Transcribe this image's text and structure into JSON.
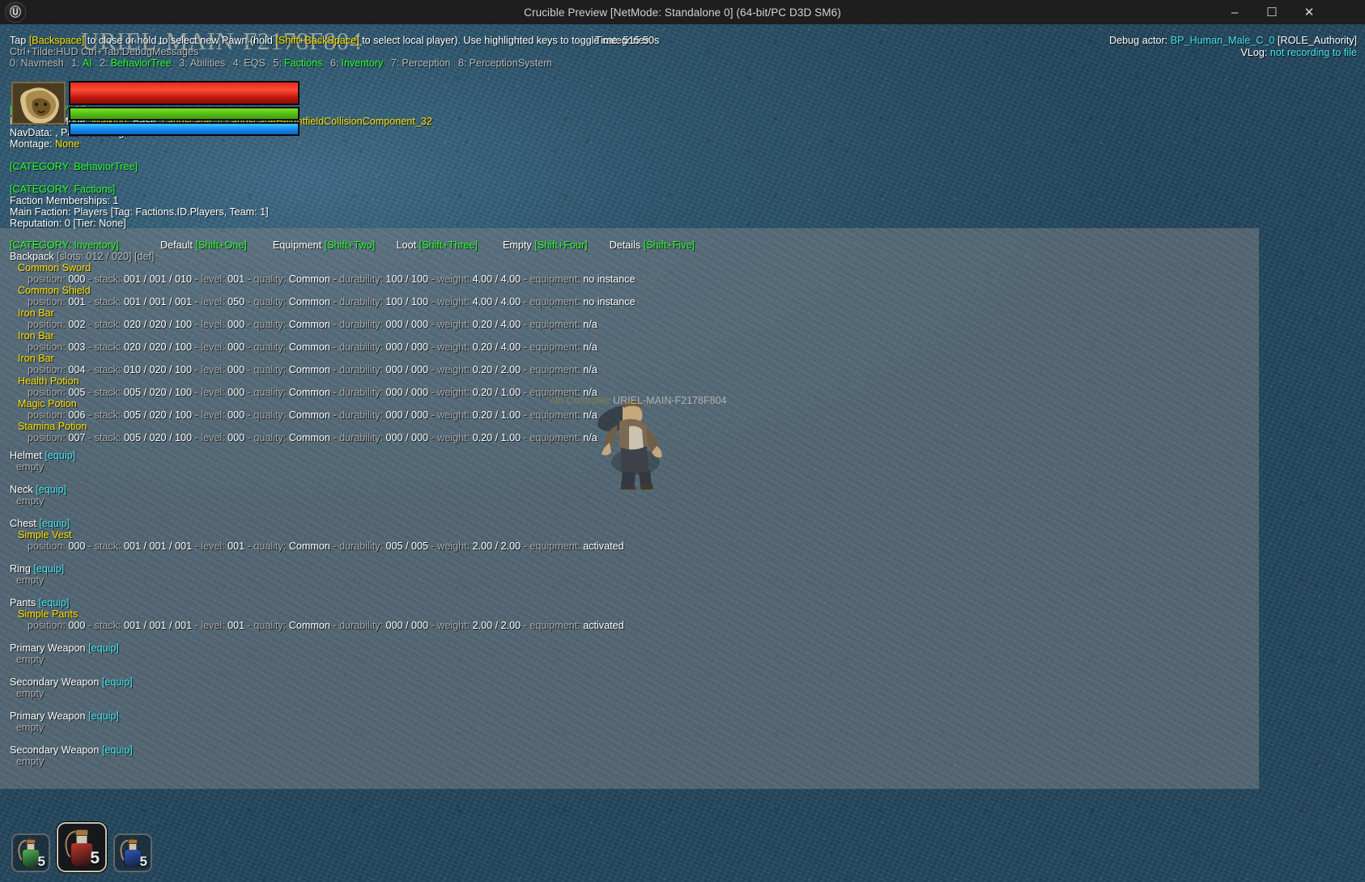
{
  "window": {
    "title": "Crucible Preview [NetMode: Standalone 0]  (64-bit/PC D3D SM6)",
    "logo_glyph": "Ⓤ",
    "minimize_glyph": "–",
    "maximize_glyph": "☐",
    "close_glyph": "✕"
  },
  "watermark": "URIEL-MAIN-F2178F804",
  "header": {
    "help_line_1_a": "Tap ",
    "help_line_1_key1": "[Backspace]",
    "help_line_1_b": " to close or hold to select new Pawn (hold ",
    "help_line_1_key2": "[Shift+BackSpace]",
    "help_line_1_c": " to select local player). Use highlighted keys to toggle categories.",
    "help_line_2": "Ctrl+Tilde:HUD  Ctrl+Tab:DebugMessages",
    "time": "Time: 515.50s",
    "debug_actor_label": "Debug actor: ",
    "debug_actor_name": "BP_Human_Male_C_0",
    "debug_actor_role": " [ROLE_Authority]",
    "vlog_label": "VLog: ",
    "vlog_value": "not recording to file"
  },
  "categories": [
    {
      "key": "0",
      "name": "Navmesh",
      "active": false
    },
    {
      "key": "1",
      "name": "AI",
      "active": true
    },
    {
      "key": "2",
      "name": "BehaviorTree",
      "active": true
    },
    {
      "key": "3",
      "name": "Abilities",
      "active": false
    },
    {
      "key": "4",
      "name": "EQS",
      "active": false
    },
    {
      "key": "5",
      "name": "Factions",
      "active": true
    },
    {
      "key": "6",
      "name": "Inventory",
      "active": true
    },
    {
      "key": "7",
      "name": "Perception",
      "active": false
    },
    {
      "key": "8",
      "name": "PerceptionSystem",
      "active": false
    }
  ],
  "category_ai": {
    "title": "[CATEGORY: AI]",
    "movement_label": "Movement Mode: ",
    "movement_value": "Walking",
    "base_label": ", Base: ",
    "base_value": "Landscape_4.LandscapeHeightfieldCollisionComponent_32",
    "navdata_line": "NavData: , Path following:",
    "montage_label": "Montage: ",
    "montage_value": "None"
  },
  "category_behaviortree": {
    "title": "[CATEGORY: BehaviorTree]"
  },
  "category_factions": {
    "title": "[CATEGORY: Factions]",
    "lines": [
      "Faction Memberships: 1",
      "Main Faction: Players [Tag: Factions.ID.Players, Team: 1]",
      "Reputation: 0 [Tier: None]"
    ]
  },
  "category_inventory": {
    "title": "[CATEGORY: Inventory]",
    "view_tabs": [
      {
        "label": "Default",
        "key": "[Shift+One]"
      },
      {
        "label": "Equipment",
        "key": "[Shift+Two]"
      },
      {
        "label": "Loot",
        "key": "[Shift+Three]"
      },
      {
        "label": "Empty",
        "key": "[Shift+Four]"
      },
      {
        "label": "Details",
        "key": "[Shift+Five]"
      }
    ],
    "backpack_label": "Backpack",
    "backpack_slots": "[slots: 012 / 020]",
    "backpack_def": "[def]",
    "items": [
      {
        "name": "Common Sword",
        "position": "000",
        "stack": "001 / 001 / 010",
        "level": "001",
        "quality": "Common",
        "durability": "100 / 100",
        "weight": "4.00 / 4.00",
        "equipment": "no instance"
      },
      {
        "name": "Common Shield",
        "position": "001",
        "stack": "001 / 001 / 001",
        "level": "050",
        "quality": "Common",
        "durability": "100 / 100",
        "weight": "4.00 / 4.00",
        "equipment": "no instance"
      },
      {
        "name": "Iron Bar",
        "position": "002",
        "stack": "020 / 020 / 100",
        "level": "000",
        "quality": "Common",
        "durability": "000 / 000",
        "weight": "0.20 / 4.00",
        "equipment": "n/a"
      },
      {
        "name": "Iron Bar",
        "position": "003",
        "stack": "020 / 020 / 100",
        "level": "000",
        "quality": "Common",
        "durability": "000 / 000",
        "weight": "0.20 / 4.00",
        "equipment": "n/a"
      },
      {
        "name": "Iron Bar",
        "position": "004",
        "stack": "010 / 020 / 100",
        "level": "000",
        "quality": "Common",
        "durability": "000 / 000",
        "weight": "0.20 / 2.00",
        "equipment": "n/a"
      },
      {
        "name": "Health Potion",
        "position": "005",
        "stack": "005 / 020 / 100",
        "level": "000",
        "quality": "Common",
        "durability": "000 / 000",
        "weight": "0.20 / 1.00",
        "equipment": "n/a"
      },
      {
        "name": "Magic Potion",
        "position": "006",
        "stack": "005 / 020 / 100",
        "level": "000",
        "quality": "Common",
        "durability": "000 / 000",
        "weight": "0.20 / 1.00",
        "equipment": "n/a"
      },
      {
        "name": "Stamina Potion",
        "position": "007",
        "stack": "005 / 020 / 100",
        "level": "000",
        "quality": "Common",
        "durability": "000 / 000",
        "weight": "0.20 / 1.00",
        "equipment": "n/a"
      }
    ],
    "field_labels": {
      "position": "position: ",
      "stack": "stack: ",
      "level": "level: ",
      "quality": "quality: ",
      "durability": "durability: ",
      "weight": "weight: ",
      "equipment": "equipment: ",
      "sep": " - "
    },
    "equip_tag": "[equip]",
    "empty_text": "empty",
    "slots": [
      {
        "name": "Helmet",
        "empty": true
      },
      {
        "name": "Neck",
        "empty": true
      },
      {
        "name": "Chest",
        "empty": false,
        "item": {
          "name": "Simple Vest",
          "position": "000",
          "stack": "001 / 001 / 001",
          "level": "001",
          "quality": "Common",
          "durability": "005 / 005",
          "weight": "2.00 / 2.00",
          "equipment": "activated"
        }
      },
      {
        "name": "Ring",
        "empty": true
      },
      {
        "name": "Pants",
        "empty": false,
        "item": {
          "name": "Simple Pants",
          "position": "000",
          "stack": "001 / 001 / 001",
          "level": "001",
          "quality": "Common",
          "durability": "000 / 000",
          "weight": "2.00 / 2.00",
          "equipment": "activated"
        }
      },
      {
        "name": "Primary Weapon",
        "empty": true
      },
      {
        "name": "Secondary Weapon",
        "empty": true
      },
      {
        "name": "Primary Weapon",
        "empty": true
      },
      {
        "name": "Secondary Weapon",
        "empty": true
      }
    ]
  },
  "character": {
    "no_controller": "No Controller",
    "session_name": "URIEL-MAIN-F2178F804"
  },
  "status_bars": {
    "health_percent": 100,
    "stamina_percent": 100,
    "mana_percent": 100
  },
  "hotbar": [
    {
      "name": "stamina-potion",
      "count": "5",
      "color": "#4eb84e",
      "selected": false
    },
    {
      "name": "health-potion",
      "count": "5",
      "color": "#c2372c",
      "selected": true
    },
    {
      "name": "magic-potion",
      "count": "5",
      "color": "#2f57c4",
      "selected": false
    }
  ],
  "colors": {
    "category_active": "#2bff2b",
    "item_name": "#ffe000",
    "equip_tag": "#46e6f0",
    "dim_label": "#b9b9b9"
  }
}
